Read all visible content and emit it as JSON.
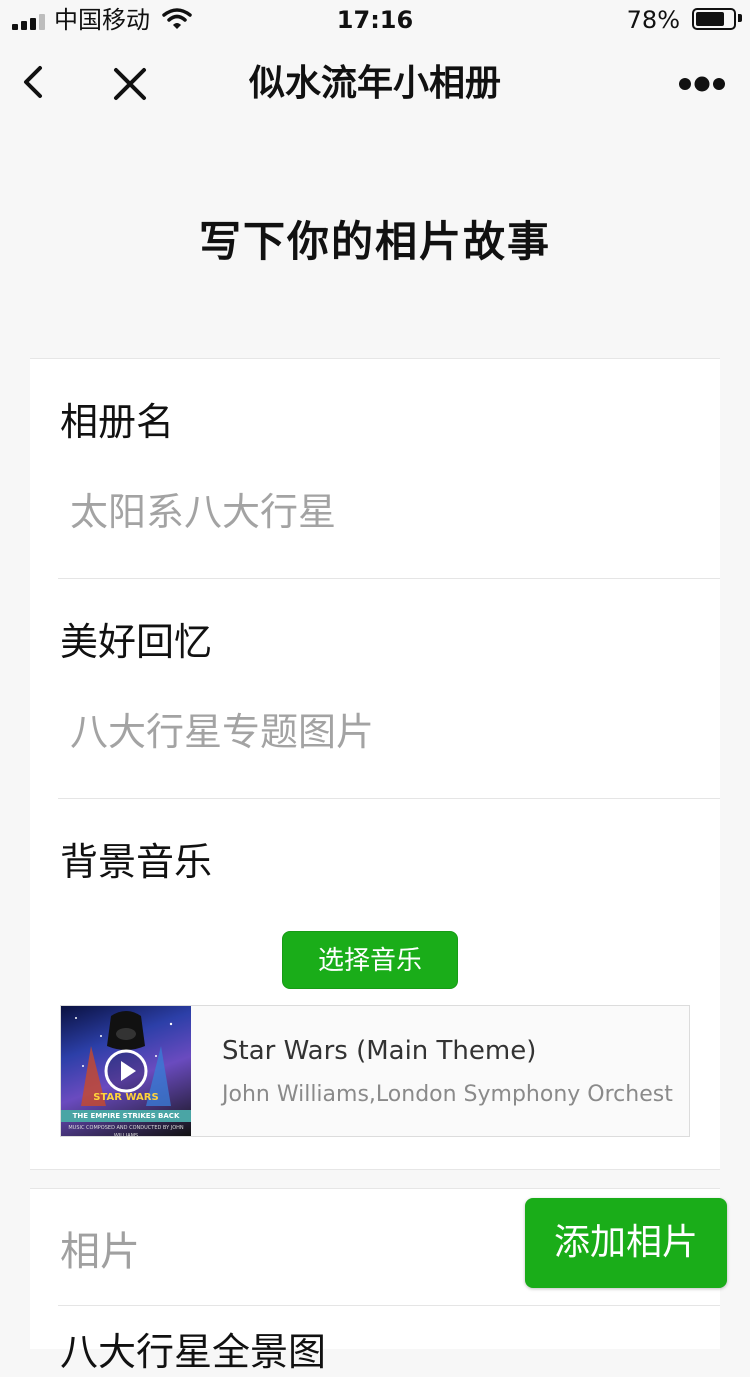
{
  "status_bar": {
    "carrier": "中国移动",
    "time": "17:16",
    "battery_text": "78%",
    "battery_level": 0.78,
    "signal_bars_active": 3,
    "signal_bars_total": 4
  },
  "nav": {
    "title": "似水流年小相册",
    "back_icon": "chevron-left-icon",
    "close_icon": "close-icon",
    "more_icon": "more-dots-icon"
  },
  "page": {
    "heading": "写下你的相片故事"
  },
  "form": {
    "album_name_label": "相册名",
    "album_name_value": "太阳系八大行星",
    "memories_label": "美好回忆",
    "memories_value": "八大行星专题图片",
    "music_label": "背景音乐",
    "select_music_button": "选择音乐"
  },
  "music": {
    "title": "Star Wars (Main Theme)",
    "artist": "John Williams,London Symphony Orchest",
    "cover_logo": "STAR WARS",
    "cover_subtitle": "THE EMPIRE STRIKES BACK",
    "cover_credit": "MUSIC COMPOSED AND CONDUCTED BY JOHN WILLIAMS"
  },
  "photos": {
    "label": "相片",
    "add_button": "添加相片",
    "next_item_label": "八大行星全景图"
  },
  "colors": {
    "accent_green": "#1aad19",
    "placeholder_gray": "#a3a3a3",
    "background": "#f7f7f7"
  }
}
